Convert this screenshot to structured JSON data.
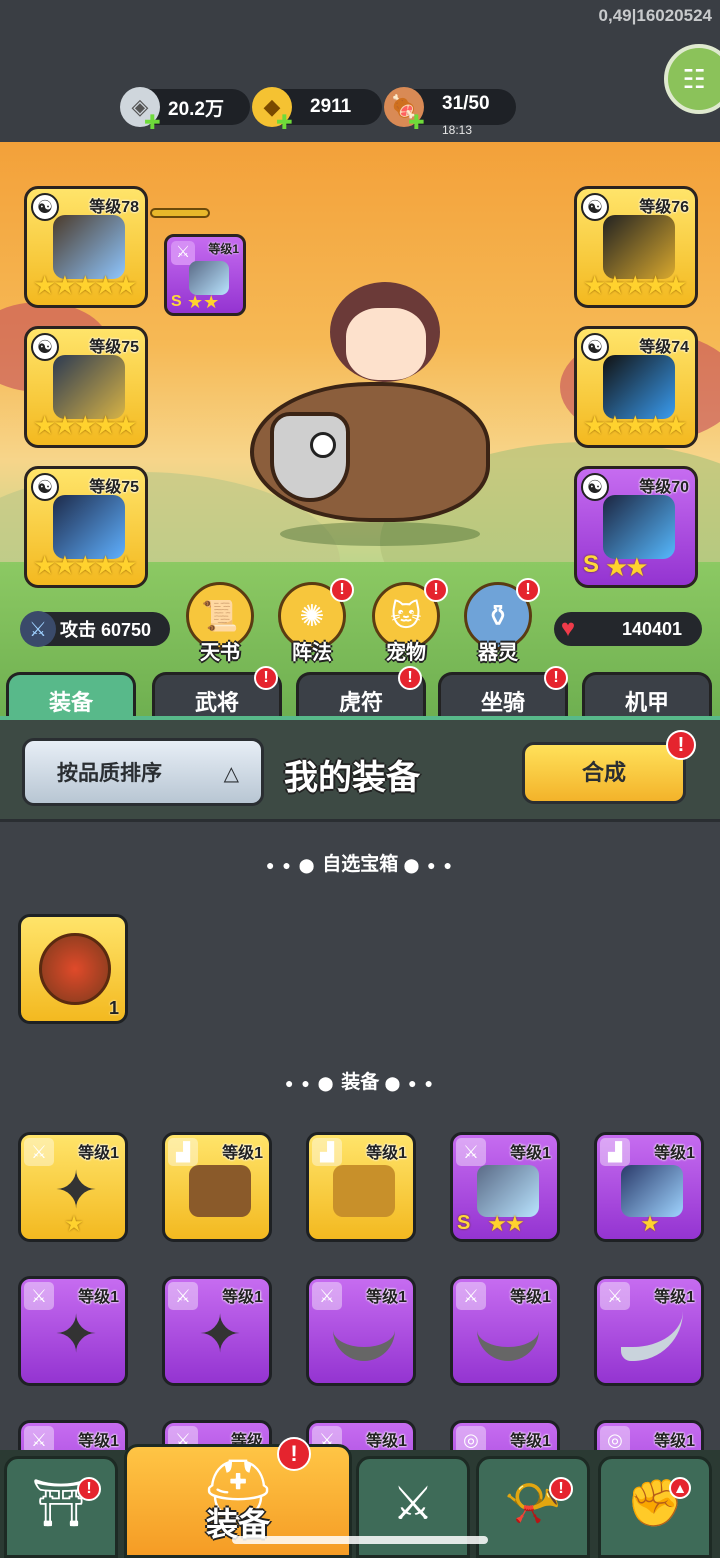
{
  "debug": "0,49|16020524",
  "resources": {
    "silver": "20.2万",
    "gold": "2911",
    "stamina": "31/50",
    "stamina_timer": "18:13"
  },
  "equipped": {
    "left": [
      {
        "level": "等级78",
        "grade": "gold",
        "stars": 5
      },
      {
        "level": "等级75",
        "grade": "gold",
        "stars": 5
      },
      {
        "level": "等级75",
        "grade": "gold",
        "stars": 5
      }
    ],
    "right": [
      {
        "level": "等级76",
        "grade": "gold",
        "stars": 5
      },
      {
        "level": "等级74",
        "grade": "gold",
        "stars": 5
      },
      {
        "level": "等级70",
        "grade": "purple",
        "stars": 3,
        "s_grade": "S"
      }
    ],
    "linked": {
      "level": "等级1",
      "s_grade": "S",
      "stars": 2
    }
  },
  "stats": {
    "attack": "攻击 60750",
    "hp": "140401"
  },
  "functions": [
    {
      "label": "天书",
      "badge": false
    },
    {
      "label": "阵法",
      "badge": true
    },
    {
      "label": "宠物",
      "badge": true
    },
    {
      "label": "器灵",
      "badge": true
    }
  ],
  "tabs": [
    {
      "label": "装备",
      "active": true,
      "badge": false
    },
    {
      "label": "武将",
      "active": false,
      "badge": true
    },
    {
      "label": "虎符",
      "active": false,
      "badge": true
    },
    {
      "label": "坐骑",
      "active": false,
      "badge": true
    },
    {
      "label": "机甲",
      "active": false,
      "badge": false
    }
  ],
  "badge_glyph": "!",
  "sort": {
    "label": "按品质排序",
    "arrow": "△",
    "title": "我的装备",
    "combine": "合成"
  },
  "sections": {
    "chest": "自选宝箱",
    "equipment": "装备"
  },
  "chest_item": {
    "count": "1"
  },
  "items": [
    {
      "level": "等级1",
      "grade": "gold",
      "type": "weapon",
      "stars": "★"
    },
    {
      "level": "等级1",
      "grade": "gold",
      "type": "boots",
      "stars": ""
    },
    {
      "level": "等级1",
      "grade": "gold",
      "type": "boots",
      "stars": ""
    },
    {
      "level": "等级1",
      "grade": "purple",
      "type": "weapon",
      "stars": "★★",
      "s_grade": "S"
    },
    {
      "level": "等级1",
      "grade": "purple",
      "type": "boots",
      "stars": "★"
    },
    {
      "level": "等级1",
      "grade": "purple",
      "type": "weapon",
      "stars": ""
    },
    {
      "level": "等级1",
      "grade": "purple",
      "type": "weapon",
      "stars": ""
    },
    {
      "level": "等级1",
      "grade": "purple",
      "type": "weapon",
      "stars": ""
    },
    {
      "level": "等级1",
      "grade": "purple",
      "type": "weapon",
      "stars": ""
    },
    {
      "level": "等级1",
      "grade": "purple",
      "type": "weapon",
      "stars": ""
    },
    {
      "level": "等级1",
      "grade": "purple",
      "type": "weapon",
      "stars": ""
    },
    {
      "level": "等级",
      "grade": "purple",
      "type": "weapon",
      "stars": ""
    },
    {
      "level": "等级1",
      "grade": "purple",
      "type": "weapon",
      "stars": ""
    },
    {
      "level": "等级1",
      "grade": "purple",
      "type": "ring",
      "stars": ""
    },
    {
      "level": "等级1",
      "grade": "purple",
      "type": "ring",
      "stars": ""
    }
  ],
  "bottom_nav": [
    {
      "name": "gate",
      "label": "",
      "badge": true
    },
    {
      "name": "equipment",
      "label": "装备",
      "badge": true,
      "active": true
    },
    {
      "name": "battle",
      "label": "",
      "badge": false
    },
    {
      "name": "summon",
      "label": "",
      "badge": true
    },
    {
      "name": "upgrade",
      "label": "",
      "badge": false
    }
  ],
  "colors": {
    "gold": "#f3b920",
    "purple": "#9434d1",
    "accent_tab": "#58b98a",
    "badge": "#e5242e"
  }
}
